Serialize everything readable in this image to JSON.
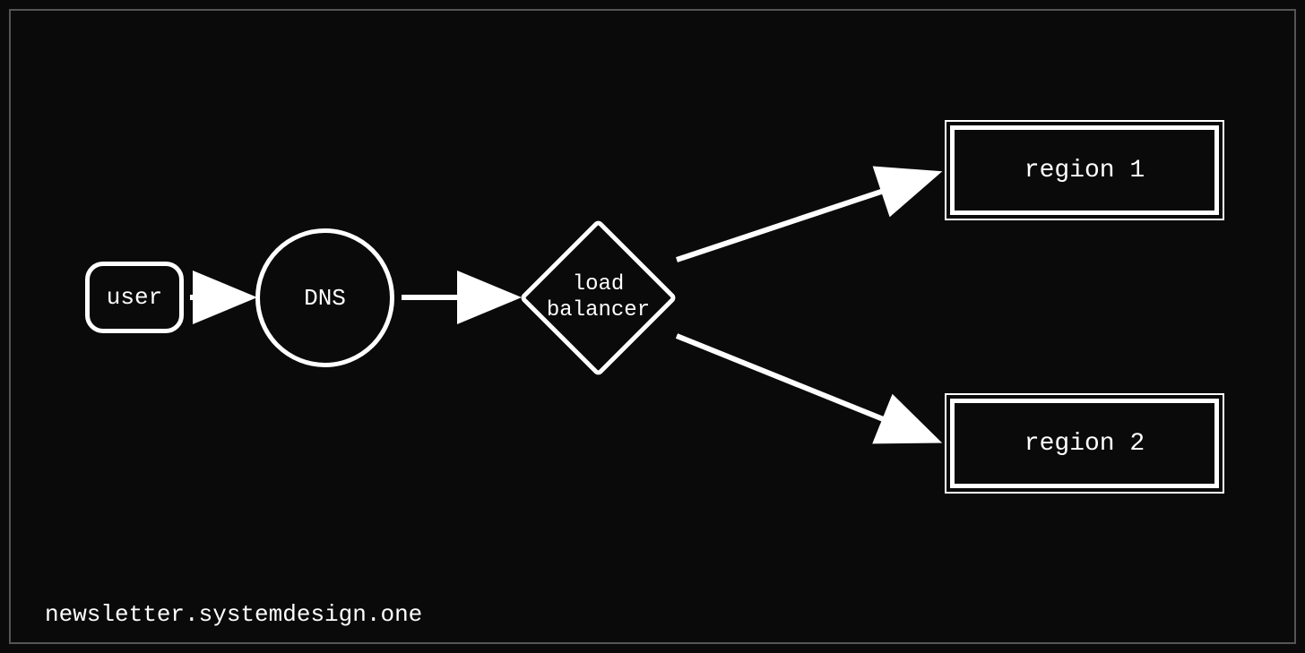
{
  "diagram": {
    "nodes": {
      "user": {
        "label": "user",
        "shape": "rounded-rect"
      },
      "dns": {
        "label": "DNS",
        "shape": "circle"
      },
      "loadBalancer": {
        "label": "load\nbalancer",
        "shape": "diamond"
      },
      "region1": {
        "label": "region 1",
        "shape": "double-rect"
      },
      "region2": {
        "label": "region 2",
        "shape": "double-rect"
      }
    },
    "edges": [
      {
        "from": "user",
        "to": "dns"
      },
      {
        "from": "dns",
        "to": "loadBalancer"
      },
      {
        "from": "loadBalancer",
        "to": "region1"
      },
      {
        "from": "loadBalancer",
        "to": "region2"
      }
    ],
    "watermark": "newsletter.systemdesign.one",
    "colors": {
      "bg": "#0a0a0a",
      "stroke": "#ffffff",
      "frame": "#555555"
    }
  }
}
